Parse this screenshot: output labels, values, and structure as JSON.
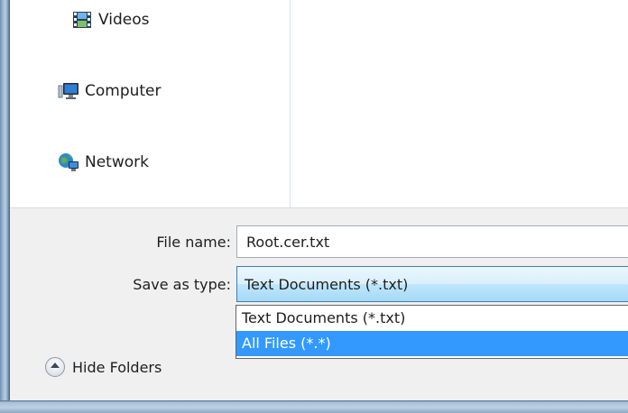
{
  "nav": {
    "items": [
      {
        "label": "Videos",
        "icon": "videos-icon"
      },
      {
        "label": "Computer",
        "icon": "computer-icon"
      },
      {
        "label": "Network",
        "icon": "network-icon"
      }
    ]
  },
  "form": {
    "file_name_label": "File name:",
    "file_name_value": "Root.cer.txt",
    "save_as_type_label": "Save as type:",
    "save_as_type_value": "Text Documents (*.txt)"
  },
  "dropdown": {
    "options": [
      {
        "label": "Text Documents (*.txt)",
        "selected": false
      },
      {
        "label": "All Files  (*.*)",
        "selected": true
      }
    ]
  },
  "footer": {
    "hide_folders_label": "Hide Folders"
  },
  "colors": {
    "selection": "#3399ff",
    "bottom_area": "#f0f0f0",
    "frame": "#7a98b6"
  }
}
